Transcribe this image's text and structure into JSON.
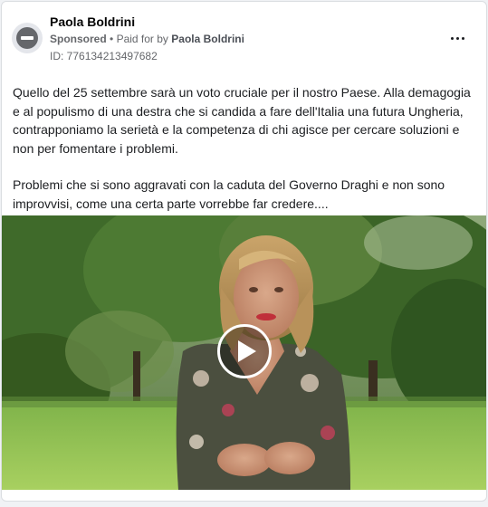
{
  "post": {
    "author": "Paola Boldrini",
    "sponsored_label": "Sponsored",
    "separator": "•",
    "paid_for_prefix": "Paid for by",
    "paid_for_by": "Paola Boldrini",
    "ad_id": "ID: 776134213497682",
    "paragraphs": [
      "Quello del 25 settembre sarà un voto cruciale per il nostro Paese. Alla demagogia e al populismo di una destra che si candida a fare dell'Italia una futura Ungheria, contrapponiamo la serietà e la competenza di chi agisce per cercare soluzioni e non per fomentare i problemi.",
      "Problemi che si sono aggravati con la caduta del Governo Draghi e non sono improvvisi, come una certa parte vorrebbe far credere...."
    ]
  },
  "icons": {
    "avatar": "restricted-avatar-icon",
    "more": "more-options-icon",
    "play": "play-icon"
  },
  "colors": {
    "text": "#1c1e21",
    "meta": "#65676b",
    "card_border": "#dadde1"
  }
}
